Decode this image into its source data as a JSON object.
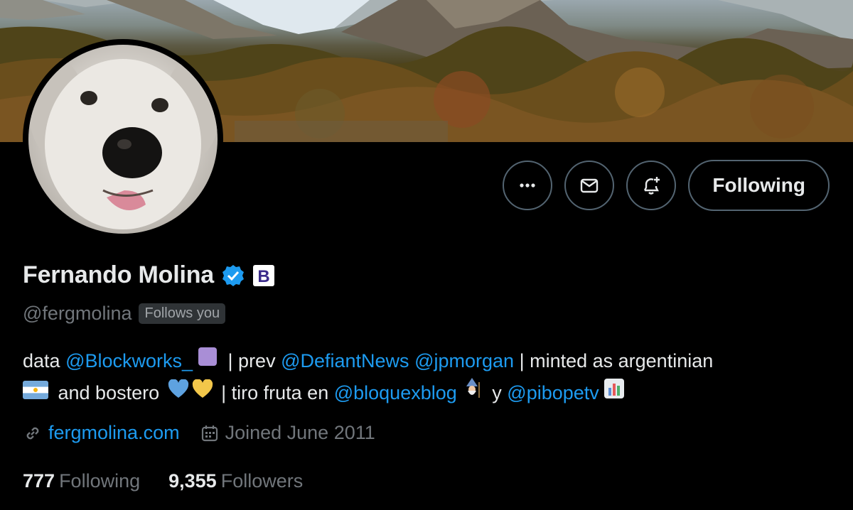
{
  "profile": {
    "name": "Fernando Molina",
    "handle": "@fergmolina",
    "follows_you": "Follows you",
    "verified_icon": "verified-badge-icon",
    "affiliate_badge": "B"
  },
  "actions": {
    "more_icon": "more-icon",
    "message_icon": "mail-icon",
    "notify_icon": "bell-plus-icon",
    "follow_label": "Following"
  },
  "bio": {
    "t1": "data ",
    "m1": "@Blockworks_",
    "t2": " | prev ",
    "m2": "@DefiantNews",
    "t3": " ",
    "m3": "@jpmorgan",
    "t4": " | minted as argentinian",
    "t5": " and bostero ",
    "t6": " | tiro fruta en ",
    "m4": "@bloquexblog",
    "t7": " y ",
    "m5": "@pibopetv"
  },
  "meta": {
    "website": "fergmolina.com",
    "joined": "Joined June 2011",
    "link_icon": "link-icon",
    "calendar_icon": "calendar-icon"
  },
  "stats": {
    "following_count": "777",
    "following_label": "Following",
    "followers_count": "9,355",
    "followers_label": "Followers"
  },
  "colors": {
    "accent": "#1d9bf0",
    "muted": "#71767b",
    "border": "#536471"
  }
}
